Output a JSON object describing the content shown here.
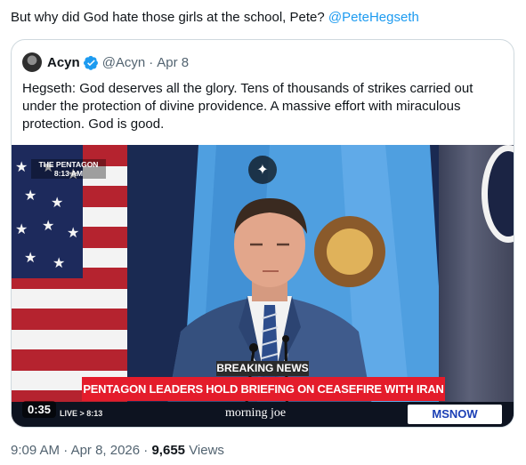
{
  "tweet": {
    "text": "But why did God hate those girls at the school, Pete?",
    "mention": "@PeteHegseth"
  },
  "quote": {
    "name": "Acyn",
    "handle": "@Acyn",
    "separator": "·",
    "date": "Apr 8",
    "body": "Hegseth: God deserves all the glory. Tens of thousands of strikes carried out under the protection of divine providence. A massive effort with miraculous protection. God is good.",
    "avatar_icon": "user-avatar",
    "verified_icon": "verified-badge-icon",
    "verified_color": "#1d9bf0"
  },
  "video": {
    "location_tag": "THE PENTAGON",
    "location_time": "8:13 AM",
    "breaking_label": "BREAKING NEWS",
    "headline": "PENTAGON LEADERS HOLD BRIEFING ON CEASEFIRE WITH IRAN",
    "live_time": "LIVE > 8:13",
    "show_name": "morning joe",
    "network": "MSNOW",
    "duration": "0:35",
    "grok_icon": "sparkle-icon",
    "headline_color": "#e41c2b"
  },
  "meta": {
    "time": "9:09 AM",
    "date": "Apr 8, 2026",
    "views_count": "9,655",
    "views_label": "Views"
  }
}
